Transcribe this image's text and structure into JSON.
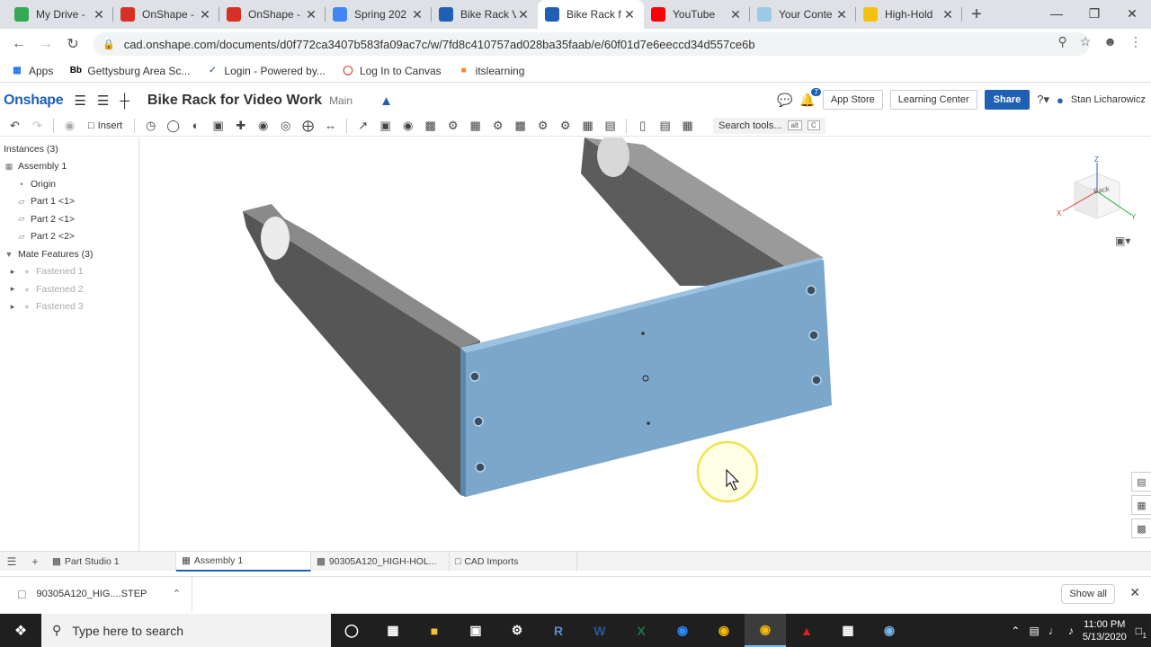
{
  "browser": {
    "tabs": [
      {
        "title": "My Drive -",
        "fav": "drive-icon",
        "color": "#34a853"
      },
      {
        "title": "OnShape -",
        "fav": "onshape-red-icon",
        "color": "#d93025"
      },
      {
        "title": "OnShape -",
        "fav": "onshape-red-icon",
        "color": "#d93025"
      },
      {
        "title": "Spring 202",
        "fav": "docs-icon",
        "color": "#4285f4"
      },
      {
        "title": "Bike Rack V",
        "fav": "onshape-icon",
        "color": "#1f5fb4"
      },
      {
        "title": "Bike Rack f",
        "fav": "onshape-icon",
        "color": "#1f5fb4"
      },
      {
        "title": "YouTube",
        "fav": "youtube-icon",
        "color": "#ff0000"
      },
      {
        "title": "Your Conte",
        "fav": "content-icon",
        "color": "#9cc9e8"
      },
      {
        "title": "High-Hold",
        "fav": "mcmaster-icon",
        "color": "#f4c20d"
      }
    ],
    "active_tab": 5,
    "url": "cad.onshape.com/documents/d0f772ca3407b583fa09ac7c/w/7fd8c410757ad028ba35faab/e/60f01d7e6eeccd34d557ce6b",
    "bookmarks": [
      {
        "label": "Apps",
        "icon": "apps-grid-icon"
      },
      {
        "label": "Gettysburg Area Sc...",
        "icon": "blackboard-icon"
      },
      {
        "label": "Login - Powered by...",
        "icon": "login-icon"
      },
      {
        "label": "Log In to Canvas",
        "icon": "canvas-icon"
      },
      {
        "label": "itslearning",
        "icon": "itslearning-icon"
      }
    ]
  },
  "onshape": {
    "logo": "Onshape",
    "doc_title": "Bike Rack for Video Work",
    "branch": "Main",
    "notification_count": "7",
    "app_store": "App Store",
    "learning_center": "Learning Center",
    "share": "Share",
    "user": "Stan Licharowicz",
    "insert": "Insert",
    "search_tools": "Search tools...",
    "search_kbd_1": "alt",
    "search_kbd_2": "C"
  },
  "tree": {
    "instances_header": "Instances (3)",
    "assembly": "Assembly 1",
    "origin": "Origin",
    "parts": [
      "Part 1 <1>",
      "Part 2 <1>",
      "Part 2 <2>"
    ],
    "mates_header": "Mate Features (3)",
    "mates": [
      "Fastened 1",
      "Fastened 2",
      "Fastened 3"
    ]
  },
  "viewcube": {
    "face": "Back",
    "z": "Z",
    "x": "X",
    "y": "Y"
  },
  "bottom_tabs": [
    {
      "label": "Part Studio 1",
      "icon": "part-studio-icon"
    },
    {
      "label": "Assembly 1",
      "icon": "assembly-icon"
    },
    {
      "label": "90305A120_HIGH-HOL...",
      "icon": "part-studio-icon"
    },
    {
      "label": "CAD Imports",
      "icon": "folder-icon"
    }
  ],
  "active_bottom_tab": 1,
  "download": {
    "file": "90305A120_HIG....STEP",
    "show_all": "Show all"
  },
  "taskbar": {
    "search_placeholder": "Type here to search",
    "time": "11:00 PM",
    "date": "5/13/2020",
    "notifications": "1"
  },
  "colors": {
    "onshape_blue": "#1f5fb4",
    "plate_blue": "#7ba7cb",
    "arm_gray": "#5a5a5a"
  }
}
